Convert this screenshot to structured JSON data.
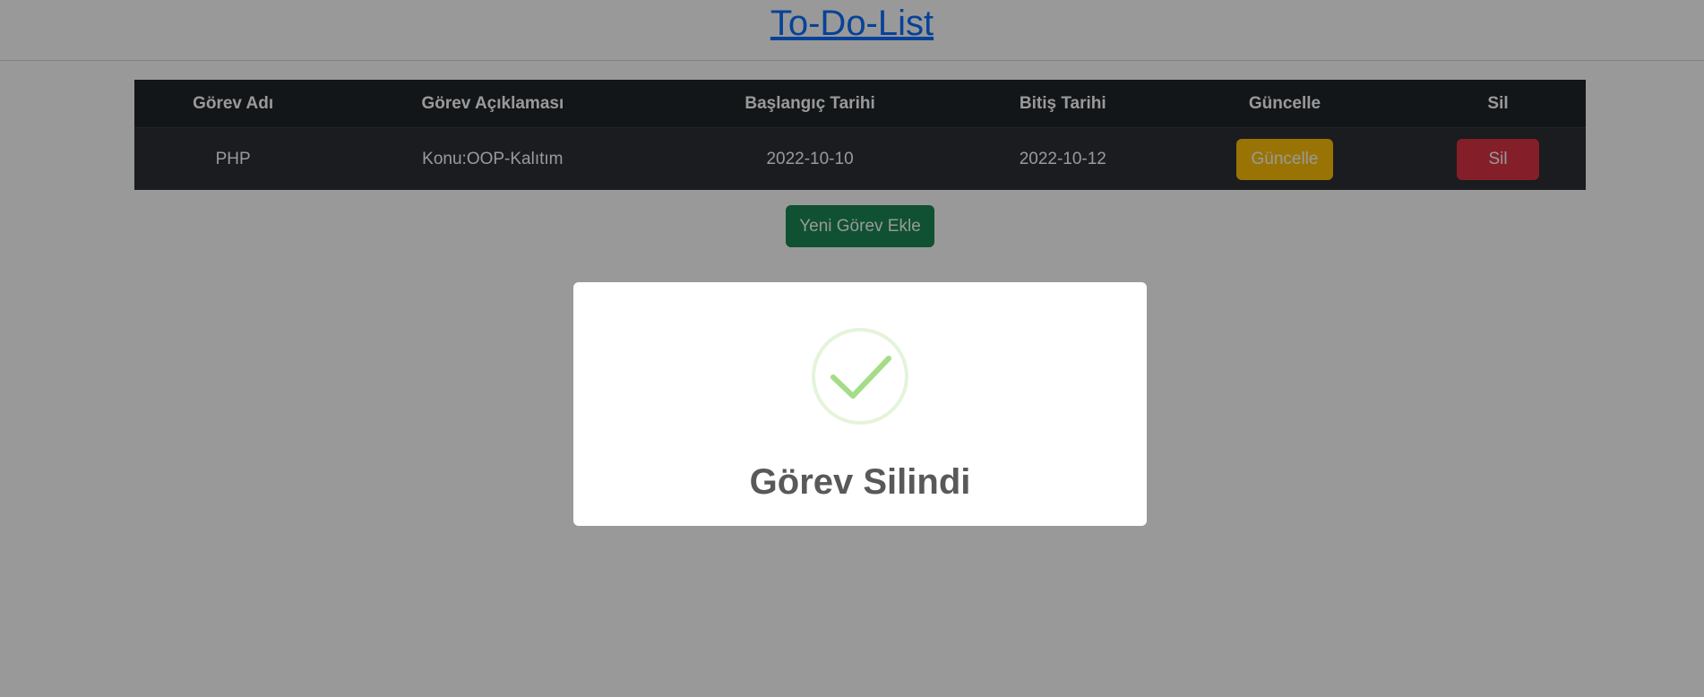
{
  "header": {
    "title": "To-Do-List"
  },
  "table": {
    "columns": [
      "Görev Adı",
      "Görev Açıklaması",
      "Başlangıç Tarihi",
      "Bitiş Tarihi",
      "Güncelle",
      "Sil"
    ],
    "rows": [
      {
        "name": "PHP",
        "description": "Konu:OOP-Kalıtım",
        "start": "2022-10-10",
        "end": "2022-10-12",
        "update_label": "Güncelle",
        "delete_label": "Sil"
      }
    ]
  },
  "actions": {
    "add_label": "Yeni Görev Ekle"
  },
  "modal": {
    "title": "Görev Silindi",
    "icon": "check-circle-icon"
  },
  "colors": {
    "link": "#0d6efd",
    "warning": "#ffc107",
    "danger": "#dc3545",
    "success": "#198754",
    "check": "#a5dc86"
  }
}
